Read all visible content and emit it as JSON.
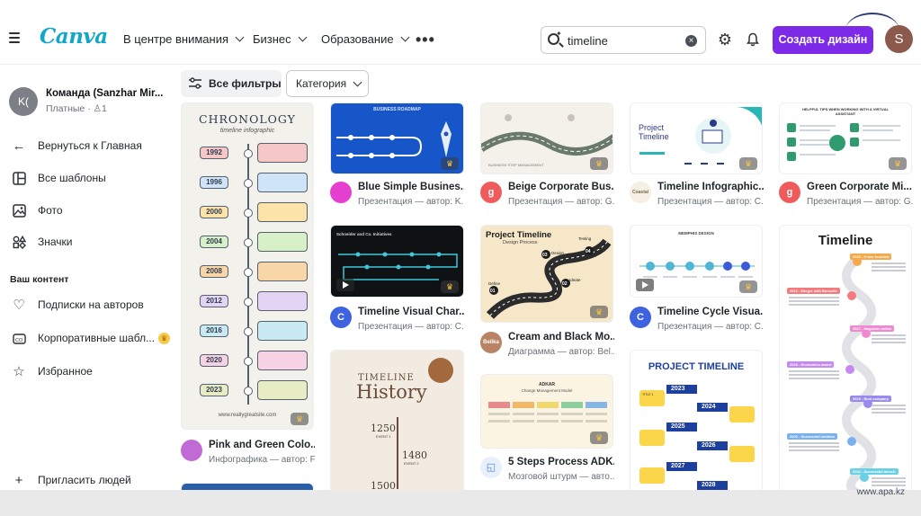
{
  "header": {
    "logo": "Canva",
    "nav": [
      "В центре внимания",
      "Бизнес",
      "Образование"
    ],
    "search_value": "timeline",
    "create_button": "Создать дизайн",
    "user_initial": "S"
  },
  "sidebar": {
    "team_initials": "K(",
    "team_name": "Команда (Sanzhar Mir...",
    "team_plan": "Платные",
    "team_members": "1",
    "back": "Вернуться к Главная",
    "items": [
      "Все шаблоны",
      "Фото",
      "Значки"
    ],
    "section_heading": "Ваш контент",
    "content_items": [
      "Подписки на авторов",
      "Корпоративные шабл...",
      "Избранное"
    ],
    "invite": "Пригласить людей"
  },
  "filters": {
    "all_filters": "Все фильтры",
    "category": "Категория"
  },
  "cards": [
    {
      "title": "Pink and Green Colo...",
      "subtitle": "Инфографика — автор: F...",
      "thumb_title": "CHRONOLOGY",
      "thumb_subtitle": "timeline infographic",
      "years": [
        "1992",
        "1996",
        "2000",
        "2004",
        "2008",
        "2012",
        "2016",
        "2020",
        "2023"
      ],
      "thumb_footer": "www.reallygreatsite.com"
    },
    {
      "title": "Blue Simple Busines...",
      "subtitle": "Презентация — автор: K...",
      "thumb_title": "BUSINESS ROADMAP"
    },
    {
      "title": "Timeline Visual Char...",
      "subtitle": "Презентация — автор: C...",
      "thumb_title": "Schneider and Co. Initiatives"
    },
    {
      "title": "",
      "subtitle": "",
      "thumb_title": "TIMELINE",
      "thumb_title2": "History",
      "years": [
        "1250",
        "1480",
        "1500"
      ],
      "events": [
        "EVENT 1",
        "EVENT 2"
      ]
    },
    {
      "title": "Beige Corporate Bus...",
      "subtitle": "Презентация — автор: G...",
      "thumb_title": "BUSINESS STEP MANAGEMENT"
    },
    {
      "title": "Cream and Black Mo...",
      "subtitle": "Диаграмма — автор: Bel...",
      "thumb_title": "Project Timeline",
      "thumb_subtitle": "Design Process",
      "steps": [
        "Define",
        "Ideate",
        "Design",
        "Testing"
      ],
      "step_numbers": [
        "01",
        "02",
        "03",
        "04"
      ]
    },
    {
      "title": "5 Steps Process ADK...",
      "subtitle": "Мозговой штурм — авто...",
      "thumb_title": "ADKAR",
      "thumb_subtitle": "Change Management Model"
    },
    {
      "title": "Timeline Infographic...",
      "subtitle": "Презентация — автор: C...",
      "thumb_title": "Project Timeline"
    },
    {
      "title": "Timeline Cycle Visua...",
      "subtitle": "Презентация — автор: C...",
      "thumb_title": "MEMPHIS DESIGN"
    },
    {
      "title": "",
      "subtitle": "",
      "thumb_title": "PROJECT TIMELINE",
      "years": [
        "2023",
        "2024",
        "2025",
        "2026",
        "2027",
        "2028"
      ],
      "thumb_label": "TITLE 1"
    },
    {
      "title": "Green Corporate Mi...",
      "subtitle": "Презентация — автор: G...",
      "thumb_title": "HELPFUL TIPS WHEN WORKING WITH A VIRTUAL ASSISTANT"
    },
    {
      "title": "",
      "subtitle": "",
      "thumb_title": "Timeline",
      "events": [
        "2015 - It was founded",
        "2016 - Merger with Boncelle",
        "2017 - Magazine article",
        "2018 - Economics award",
        "2019 - Best company",
        "2020 - Successful solution",
        "2022 - Successful launch"
      ]
    }
  ],
  "card_avatars": {
    "c1": "",
    "c2": "",
    "c3": "C",
    "c5": "g",
    "c6": "Belika",
    "c8": "Coastal",
    "c9": "C",
    "c11": "g"
  },
  "footer": {
    "url": "www.apa.kz"
  },
  "colors": {
    "brand": "#12a6c8",
    "accent": "#7d2ae8"
  }
}
